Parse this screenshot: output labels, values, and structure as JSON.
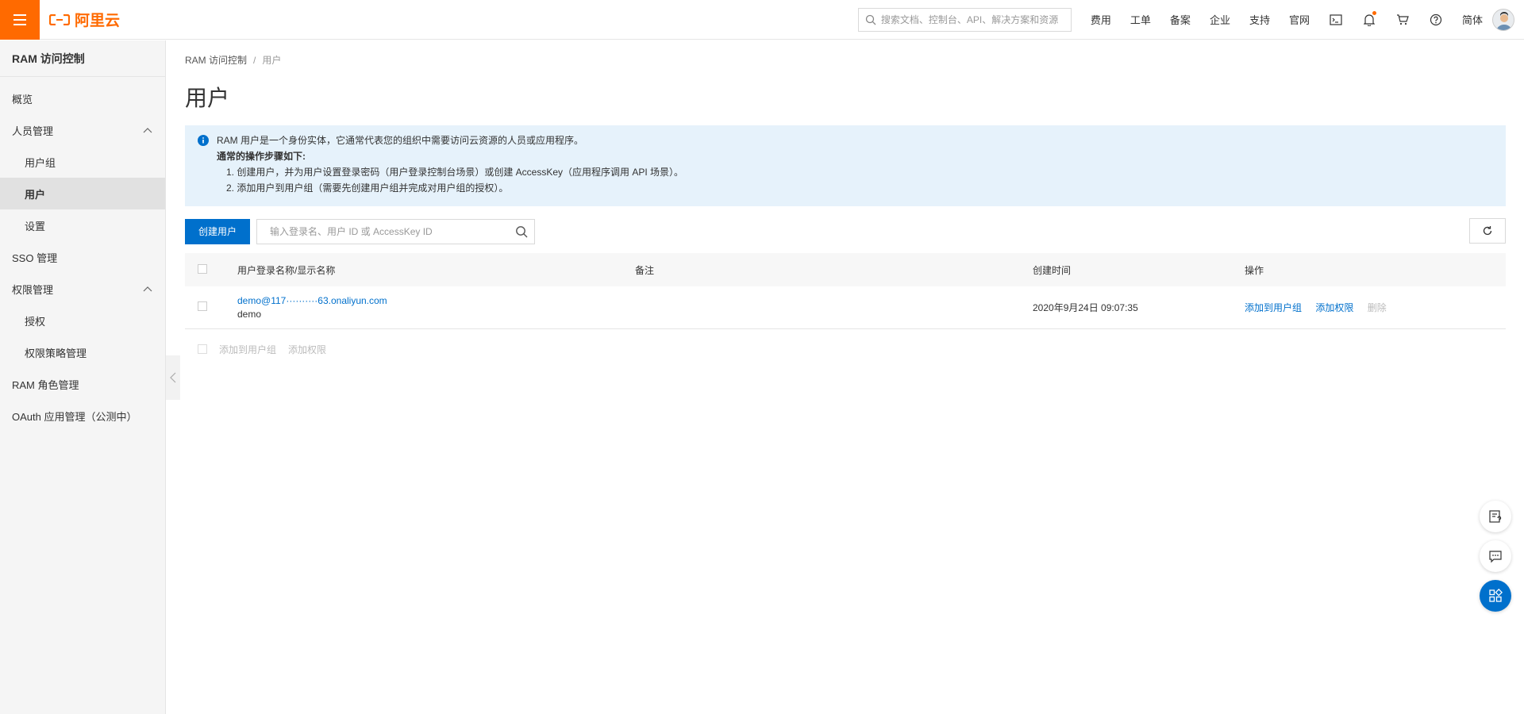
{
  "topbar": {
    "logo_text": "阿里云",
    "search_placeholder": "搜索文档、控制台、API、解决方案和资源",
    "nav": [
      "费用",
      "工单",
      "备案",
      "企业",
      "支持",
      "官网"
    ],
    "lang": "简体",
    "accent": "#ff6a00"
  },
  "sidebar": {
    "title": "RAM 访问控制",
    "items": {
      "overview": "概览",
      "people": "人员管理",
      "groups": "用户组",
      "users": "用户",
      "settings": "设置",
      "sso": "SSO 管理",
      "permissions": "权限管理",
      "grant": "授权",
      "policies": "权限策略管理",
      "roles": "RAM 角色管理",
      "oauth": "OAuth 应用管理（公测中）"
    }
  },
  "breadcrumb": {
    "root": "RAM 访问控制",
    "sep": "/",
    "current": "用户"
  },
  "page_title": "用户",
  "info": {
    "line1": "RAM 用户是一个身份实体，它通常代表您的组织中需要访问云资源的人员或应用程序。",
    "line2": "通常的操作步骤如下:",
    "step1": "1. 创建用户，并为用户设置登录密码（用户登录控制台场景）或创建 AccessKey（应用程序调用 API 场景）。",
    "step2": "2. 添加用户到用户组（需要先创建用户组并完成对用户组的授权）。"
  },
  "toolbar": {
    "create_label": "创建用户",
    "search_placeholder": "输入登录名、用户 ID 或 AccessKey ID"
  },
  "table": {
    "headers": {
      "name": "用户登录名称/显示名称",
      "note": "备注",
      "created": "创建时间",
      "ops": "操作"
    },
    "rows": [
      {
        "login": "demo@117··········63.onaliyun.com",
        "display": "demo",
        "note": "",
        "created": "2020年9月24日 09:07:35",
        "op_add_group": "添加到用户组",
        "op_add_perm": "添加权限",
        "op_delete": "删除"
      }
    ]
  },
  "batch": {
    "add_group": "添加到用户组",
    "add_perm": "添加权限"
  },
  "colors": {
    "primary": "#0070cc",
    "info_bg": "#e6f2fb"
  }
}
